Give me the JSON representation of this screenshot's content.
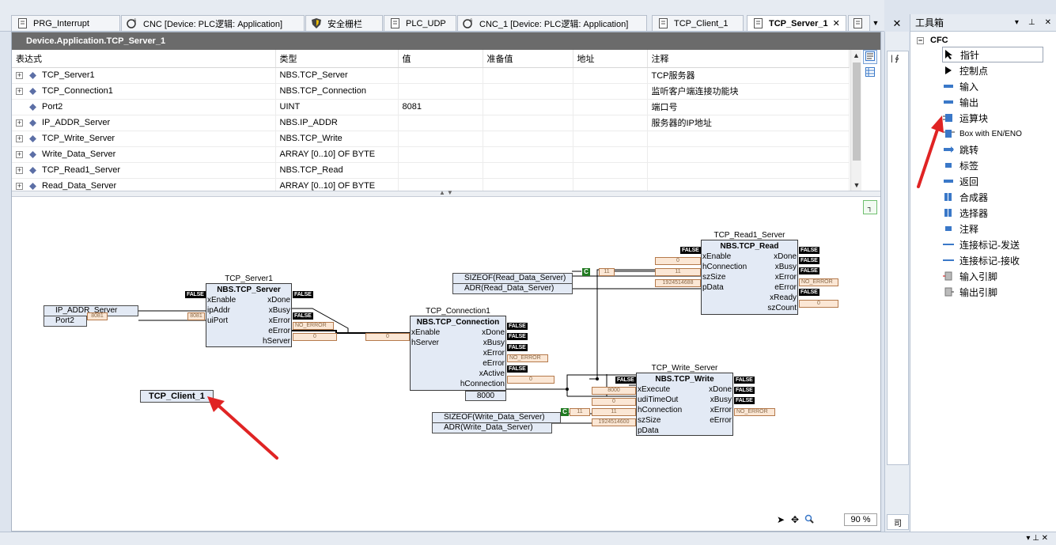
{
  "tabs": [
    {
      "label": "PRG_Interrupt",
      "icon": "document-icon"
    },
    {
      "label": "CNC [Device: PLC逻辑: Application]",
      "icon": "cnc-icon"
    },
    {
      "label": "安全栅栏",
      "icon": "shield-icon"
    },
    {
      "label": "PLC_UDP",
      "icon": "document-icon"
    },
    {
      "label": "CNC_1 [Device: PLC逻辑: Application]",
      "icon": "cnc-icon"
    },
    {
      "label": "TCP_Client_1",
      "icon": "document-icon"
    },
    {
      "label": "TCP_Server_1",
      "icon": "document-icon",
      "active": true,
      "close": "✕"
    }
  ],
  "editor": {
    "path": "Device.Application.TCP_Server_1",
    "columns": [
      "表达式",
      "类型",
      "值",
      "准备值",
      "地址",
      "注释"
    ],
    "rows": [
      {
        "expand": "+",
        "name": "TCP_Server1",
        "type": "NBS.TCP_Server",
        "value": "",
        "prepared": "",
        "address": "",
        "comment": "TCP服务器"
      },
      {
        "expand": "+",
        "name": "TCP_Connection1",
        "type": "NBS.TCP_Connection",
        "value": "",
        "prepared": "",
        "address": "",
        "comment": "监听客户端连接功能块"
      },
      {
        "expand": "",
        "name": "Port2",
        "type": "UINT",
        "value": "8081",
        "prepared": "",
        "address": "",
        "comment": "端口号"
      },
      {
        "expand": "+",
        "name": "IP_ADDR_Server",
        "type": "NBS.IP_ADDR",
        "value": "",
        "prepared": "",
        "address": "",
        "comment": "服务器的IP地址"
      },
      {
        "expand": "+",
        "name": "TCP_Write_Server",
        "type": "NBS.TCP_Write",
        "value": "",
        "prepared": "",
        "address": "",
        "comment": ""
      },
      {
        "expand": "+",
        "name": "Write_Data_Server",
        "type": "ARRAY [0..10] OF BYTE",
        "value": "",
        "prepared": "",
        "address": "",
        "comment": ""
      },
      {
        "expand": "+",
        "name": "TCP_Read1_Server",
        "type": "NBS.TCP_Read",
        "value": "",
        "prepared": "",
        "address": "",
        "comment": ""
      },
      {
        "expand": "+",
        "name": "Read_Data_Server",
        "type": "ARRAY [0..10] OF BYTE",
        "value": "",
        "prepared": "",
        "address": "",
        "comment": ""
      }
    ]
  },
  "cfc": {
    "server": {
      "instance": "TCP_Server1",
      "type": "NBS.TCP_Server",
      "inputs": [
        "xEnable",
        "ipAddr",
        "uiPort"
      ],
      "outputs": [
        "xDone",
        "xBusy",
        "xError",
        "eError",
        "hServer"
      ]
    },
    "connection": {
      "instance": "TCP_Connection1",
      "type": "NBS.TCP_Connection",
      "inputs": [
        "xEnable",
        "hServer"
      ],
      "outputs": [
        "xDone",
        "xBusy",
        "xError",
        "eError",
        "xActive",
        "hConnection"
      ],
      "const": "8000"
    },
    "read": {
      "instance": "TCP_Read1_Server",
      "type": "NBS.TCP_Read",
      "inputs": [
        "xEnable",
        "hConnection",
        "szSize",
        "pData"
      ],
      "outputs": [
        "xDone",
        "xBusy",
        "xError",
        "eError",
        "xReady",
        "szCount"
      ]
    },
    "write": {
      "instance": "TCP_Write_Server",
      "type": "NBS.TCP_Write",
      "inputs": [
        "xExecute",
        "udiTimeOut",
        "hConnection",
        "szSize",
        "pData"
      ],
      "outputs": [
        "xDone",
        "xBusy",
        "xError",
        "eError"
      ]
    },
    "input_boxes": {
      "ip_addr": "IP_ADDR_Server",
      "port": "Port2",
      "sizeof_read": "SIZEOF(Read_Data_Server)",
      "adr_read": "ADR(Read_Data_Server)",
      "sizeof_write": "SIZEOF(Write_Data_Server)",
      "adr_write": "ADR(Write_Data_Server)"
    },
    "output_box": "TCP_Client_1",
    "flags": {
      "false": "FALSE",
      "no_error": "NO_ERROR",
      "c": "C"
    },
    "values": {
      "port": "8081",
      "zero": "0",
      "eleven": "11",
      "addr_read": "1924514688",
      "addr_write": "1924514600",
      "timeout": "8000"
    },
    "zoom": "90 %"
  },
  "toolbox": {
    "title": "工具箱",
    "group": "CFC",
    "items": [
      {
        "label": "指针",
        "icon": "pointer-icon"
      },
      {
        "label": "控制点",
        "icon": "control-point-icon"
      },
      {
        "label": "输入",
        "icon": "input-icon"
      },
      {
        "label": "输出",
        "icon": "output-icon"
      },
      {
        "label": "运算块",
        "icon": "box-icon"
      },
      {
        "label": "Box with EN/ENO",
        "icon": "box-en-eno-icon"
      },
      {
        "label": "跳转",
        "icon": "jump-icon"
      },
      {
        "label": "标签",
        "icon": "label-icon"
      },
      {
        "label": "返回",
        "icon": "return-icon"
      },
      {
        "label": "合成器",
        "icon": "composer-icon"
      },
      {
        "label": "选择器",
        "icon": "selector-icon"
      },
      {
        "label": "注释",
        "icon": "comment-icon"
      },
      {
        "label": "连接标记-发送",
        "icon": "connection-mark-send-icon"
      },
      {
        "label": "连接标记-接收",
        "icon": "connection-mark-receive-icon"
      },
      {
        "label": "输入引脚",
        "icon": "input-pin-icon"
      },
      {
        "label": "输出引脚",
        "icon": "output-pin-icon"
      }
    ]
  },
  "narrow_panel": {
    "lower_label": "司"
  },
  "colors": {
    "accent": "#3a78c8",
    "false_flag": "#000000",
    "value_box": "#fbe7d5",
    "block_fill": "#e3eaf5",
    "arrow": "#e02424"
  }
}
